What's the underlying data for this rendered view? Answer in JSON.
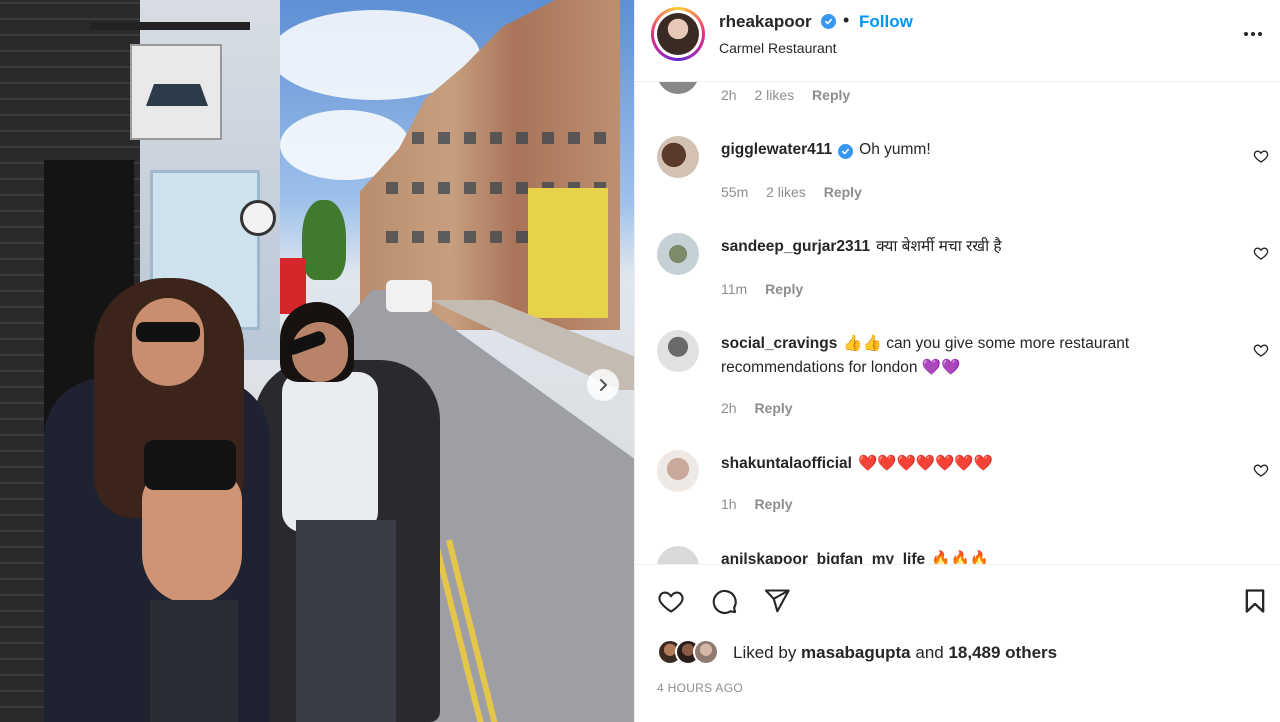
{
  "post": {
    "username": "rheakapoor",
    "verified": true,
    "dot": "•",
    "follow_label": "Follow",
    "location": "Carmel Restaurant"
  },
  "photo": {
    "next_icon": "chevron-right-icon"
  },
  "comments": [
    {
      "username": "",
      "text": "",
      "time": "2h",
      "likes": "2 likes",
      "reply": "Reply",
      "partial": "top"
    },
    {
      "username": "gigglewater411",
      "verified": true,
      "text": "Oh yumm!",
      "time": "55m",
      "likes": "2 likes",
      "reply": "Reply"
    },
    {
      "username": "sandeep_gurjar2311",
      "verified": false,
      "text": "क्या बेशर्मी मचा रखी है",
      "time": "11m",
      "likes": "",
      "reply": "Reply"
    },
    {
      "username": "social_cravings",
      "verified": false,
      "text": "👍👍 can you give some more restaurant recommendations for london 💜💜",
      "time": "2h",
      "likes": "",
      "reply": "Reply"
    },
    {
      "username": "shakuntalaofficial",
      "verified": false,
      "text": "❤️❤️❤️❤️❤️❤️❤️",
      "time": "1h",
      "likes": "",
      "reply": "Reply"
    },
    {
      "username": "anilskapoor_bigfan_my_life",
      "verified": false,
      "text": "🔥🔥🔥",
      "partial": "bottom"
    }
  ],
  "actions": {
    "like_icon": "heart-icon",
    "comment_icon": "comment-icon",
    "share_icon": "share-icon",
    "save_icon": "bookmark-icon"
  },
  "likes": {
    "prefix": "Liked by ",
    "user": "masabagupta",
    "middle": " and ",
    "count": "18,489 others"
  },
  "timestamp": "4 HOURS AGO",
  "colors": {
    "accent": "#0095f6",
    "verified": "#3897f0",
    "muted": "#8e8e8e",
    "text": "#262626"
  }
}
